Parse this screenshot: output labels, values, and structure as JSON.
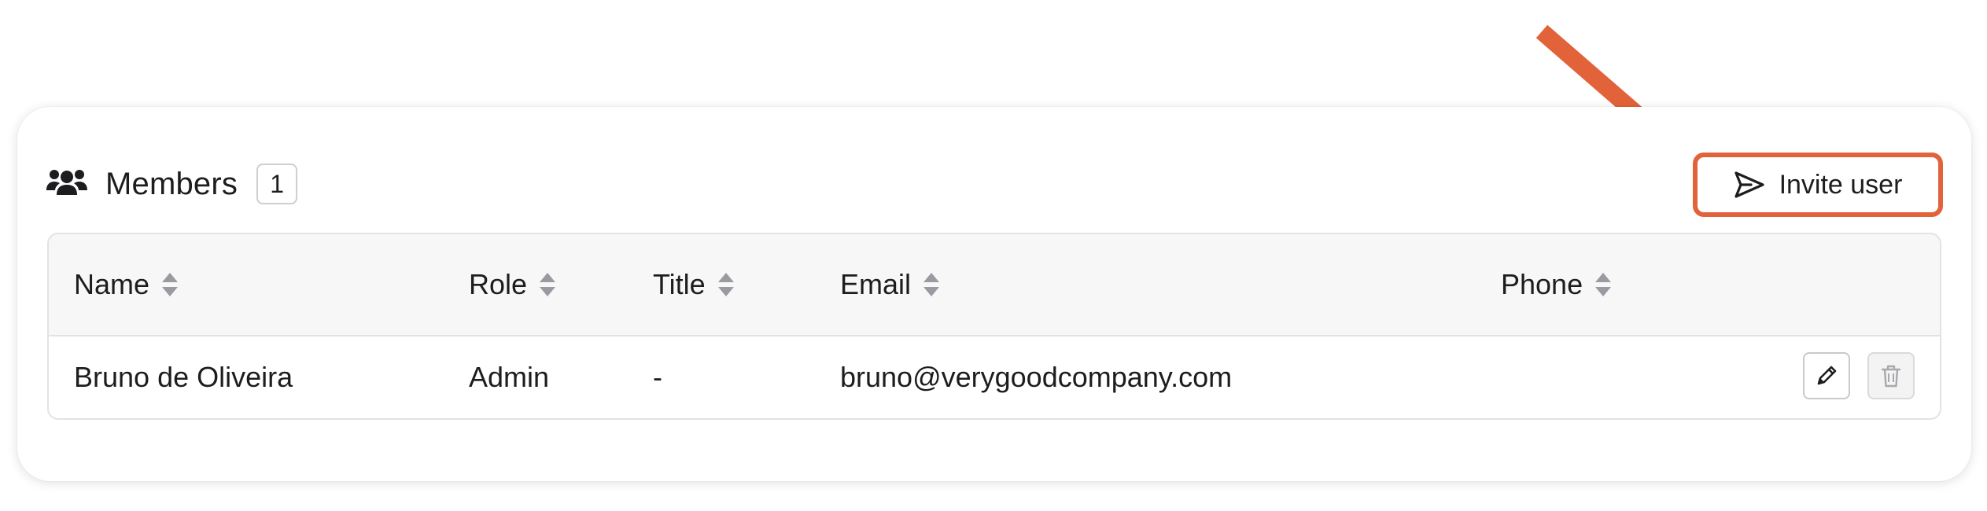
{
  "members": {
    "title": "Members",
    "count": "1",
    "invite_label": "Invite user"
  },
  "table": {
    "columns": [
      {
        "key": "name",
        "label": "Name"
      },
      {
        "key": "role",
        "label": "Role"
      },
      {
        "key": "title",
        "label": "Title"
      },
      {
        "key": "email",
        "label": "Email"
      },
      {
        "key": "phone",
        "label": "Phone"
      }
    ],
    "rows": [
      {
        "name": "Bruno de Oliveira",
        "role": "Admin",
        "title": "-",
        "email": "bruno@verygoodcompany.com",
        "phone": ""
      }
    ]
  },
  "icons": {
    "members": "users-icon",
    "invite": "send-icon",
    "sort": "sort-icon",
    "edit": "pencil-icon",
    "delete": "trash-icon"
  },
  "colors": {
    "highlight": "#e2633a",
    "text": "#1d1d1f",
    "header_bg": "#f7f7f8",
    "sort_icon": "#9a9aa0"
  }
}
